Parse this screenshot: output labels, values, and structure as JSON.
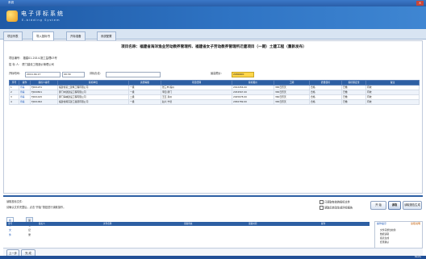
{
  "window": {
    "title": "系统",
    "close_label": "×"
  },
  "banner": {
    "brand": "电子评标系统",
    "brand_sub": "E-bidding System"
  },
  "tabs": [
    {
      "label": "项目列表"
    },
    {
      "label": "导入投标书"
    },
    {
      "label": "开标准备"
    },
    {
      "label": "系统配置"
    }
  ],
  "project": {
    "title": "项目名称：福建省海洋渔业劳动教养管理所、福建省女子劳动教养管理所迁建项目（一期）土建工程（重新发布）",
    "no_label": "项目编号：",
    "no_value": "福建01-2014-施工监理03号",
    "agency_label": "招 标 人：",
    "agency_value": "厦门建设工程造价管理公司"
  },
  "filters": {
    "date_label": "开标时间：",
    "date_value": "2014-09-17",
    "time_value": "09:30",
    "type_label": "评标办法：",
    "type_value": "",
    "amount_label": "最高限价：",
    "amount_value": "2080000"
  },
  "grid": {
    "columns": [
      "序号",
      "操作",
      "投标人编号",
      "投标单位",
      "资质等级",
      "项目经理",
      "投标报价",
      "工期",
      "质量目标",
      "投标保证金",
      "备注"
    ],
    "rows": [
      [
        "1",
        "查看",
        "FJ001231",
        "福建省第二建筑工程有限公司",
        "一级",
        "张三丰 福州",
        "2012456.00",
        "365日历天",
        "合格",
        "已缴",
        "有效"
      ],
      [
        "2",
        "查看",
        "FJ000821",
        "厦门中建建设工程有限公司",
        "一级",
        "李四 厦门",
        "2034567.00",
        "365日历天",
        "合格",
        "已缴",
        "有效"
      ],
      [
        "3",
        "查看",
        "FJ001445",
        "厦门海峡建设工程有限公司",
        "二级",
        "王五 泉州",
        "2045678.00",
        "360日历天",
        "合格",
        "已缴",
        "有效"
      ],
      [
        "4",
        "查看",
        "FJ001092",
        "福建省闽东建工集团有限公司",
        "一级",
        "赵六 宁德",
        "2056789.00",
        "365日历天",
        "合格",
        "已缴",
        "有效"
      ]
    ]
  },
  "lower": {
    "note_title": "读取投标文件：",
    "note_text": "请确认文件完整后，点击“开始”按钮进行读取操作。",
    "check1": "只读取有效的投标文件",
    "check2": "读取后自动生成评标报告",
    "btn_start": "开 始",
    "btn_primary": "读取",
    "btn_next": "读取报告生成",
    "subtabs": [
      "投标文件",
      "读取记录"
    ],
    "subgrid_cols": [
      "序号",
      "投标人",
      "文件名称",
      "读取状态",
      "读取时间",
      "操作"
    ],
    "side_title": "操作提示",
    "side_title2": "读取说明",
    "side_items": [
      "文件完整性校验",
      "数据读取",
      "报表生成",
      "结果确认"
    ],
    "btn_prev": "上一步",
    "btn_finish": "完 成"
  },
  "status": {
    "text": "Ready"
  }
}
